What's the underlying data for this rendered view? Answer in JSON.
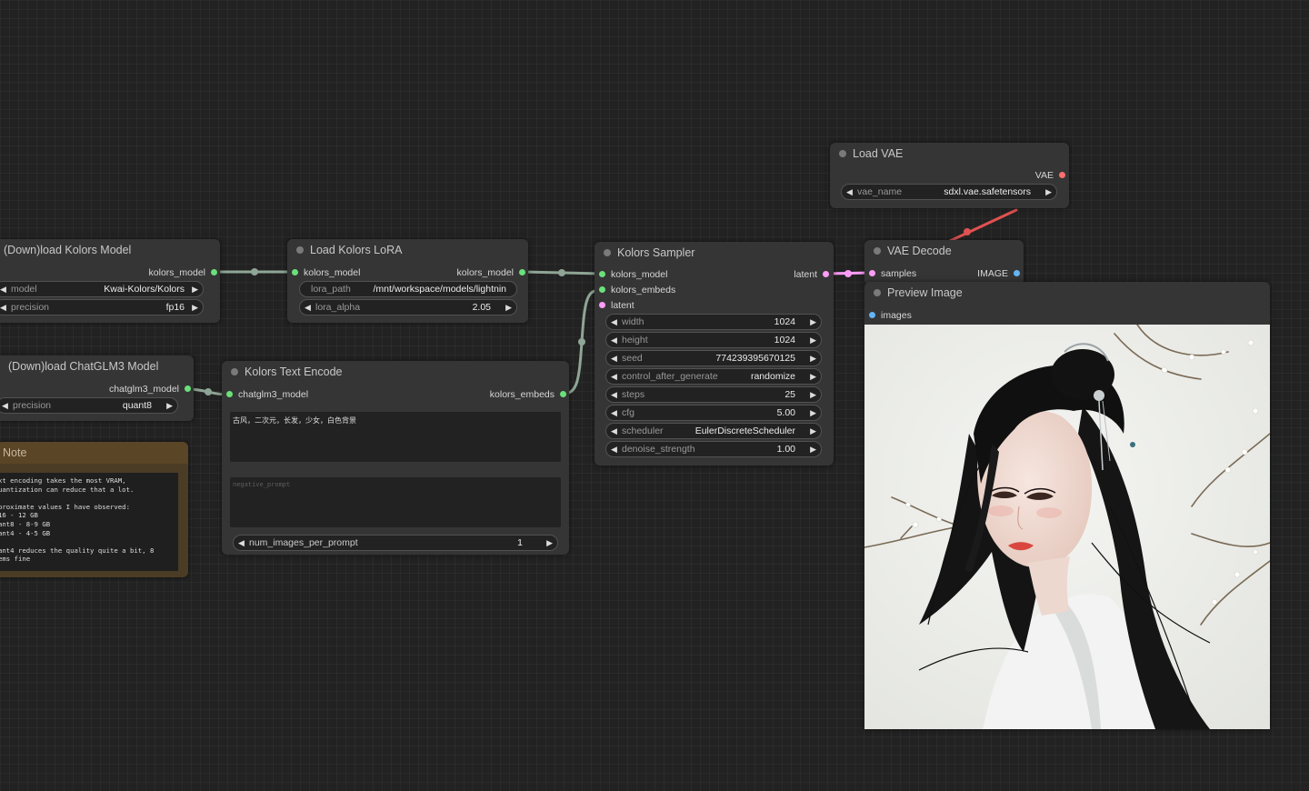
{
  "nodes": {
    "kolors_model": {
      "title": "(Down)load Kolors Model",
      "output": "kolors_model",
      "widgets": [
        {
          "name": "model",
          "value": "Kwai-Kolors/Kolors"
        },
        {
          "name": "precision",
          "value": "fp16"
        }
      ]
    },
    "lora": {
      "title": "Load Kolors LoRA",
      "input": "kolors_model",
      "output": "kolors_model",
      "widgets": [
        {
          "name": "lora_path",
          "value": "/mnt/workspace/models/lightnin"
        },
        {
          "name": "lora_alpha",
          "value": "2.05"
        }
      ]
    },
    "chatglm": {
      "title": "(Down)load ChatGLM3 Model",
      "output": "chatglm3_model",
      "widgets": [
        {
          "name": "precision",
          "value": "quant8"
        }
      ]
    },
    "note": {
      "title": "Note",
      "text": "xt encoding takes the most VRAM,\nuantization can reduce that a lot.\n\nproximate values I have observed:\n16 - 12 GB\nant8 - 8-9 GB\nant4 - 4-5 GB\n\nant4 reduces the quality quite a bit, 8\nems fine"
    },
    "text_encode": {
      "title": "Kolors Text Encode",
      "input": "chatglm3_model",
      "output": "kolors_embeds",
      "prompt": "古风，二次元，长发，少女，白色背景",
      "negative_placeholder": "negative_prompt",
      "widgets": [
        {
          "name": "num_images_per_prompt",
          "value": "1"
        }
      ]
    },
    "sampler": {
      "title": "Kolors Sampler",
      "inputs": [
        "kolors_model",
        "kolors_embeds",
        "latent"
      ],
      "output": "latent",
      "widgets": [
        {
          "name": "width",
          "value": "1024"
        },
        {
          "name": "height",
          "value": "1024"
        },
        {
          "name": "seed",
          "value": "774239395670125"
        },
        {
          "name": "control_after_generate",
          "value": "randomize"
        },
        {
          "name": "steps",
          "value": "25"
        },
        {
          "name": "cfg",
          "value": "5.00"
        },
        {
          "name": "scheduler",
          "value": "EulerDiscreteScheduler"
        },
        {
          "name": "denoise_strength",
          "value": "1.00"
        }
      ]
    },
    "load_vae": {
      "title": "Load VAE",
      "output": "VAE",
      "widgets": [
        {
          "name": "vae_name",
          "value": "sdxl.vae.safetensors"
        }
      ]
    },
    "vae_decode": {
      "title": "VAE Decode",
      "input": "samples",
      "output": "IMAGE"
    },
    "preview": {
      "title": "Preview Image",
      "input": "images"
    }
  },
  "colors": {
    "model_slot": "#6be07a",
    "latent_slot": "#ff9cf9",
    "vae_slot": "#ff6e6e",
    "image_slot": "#64b5f6",
    "model_link": "#8fa596",
    "latent_link": "#ff9cf9",
    "vae_link": "#e05252",
    "note_bg": "#4a3c25"
  }
}
